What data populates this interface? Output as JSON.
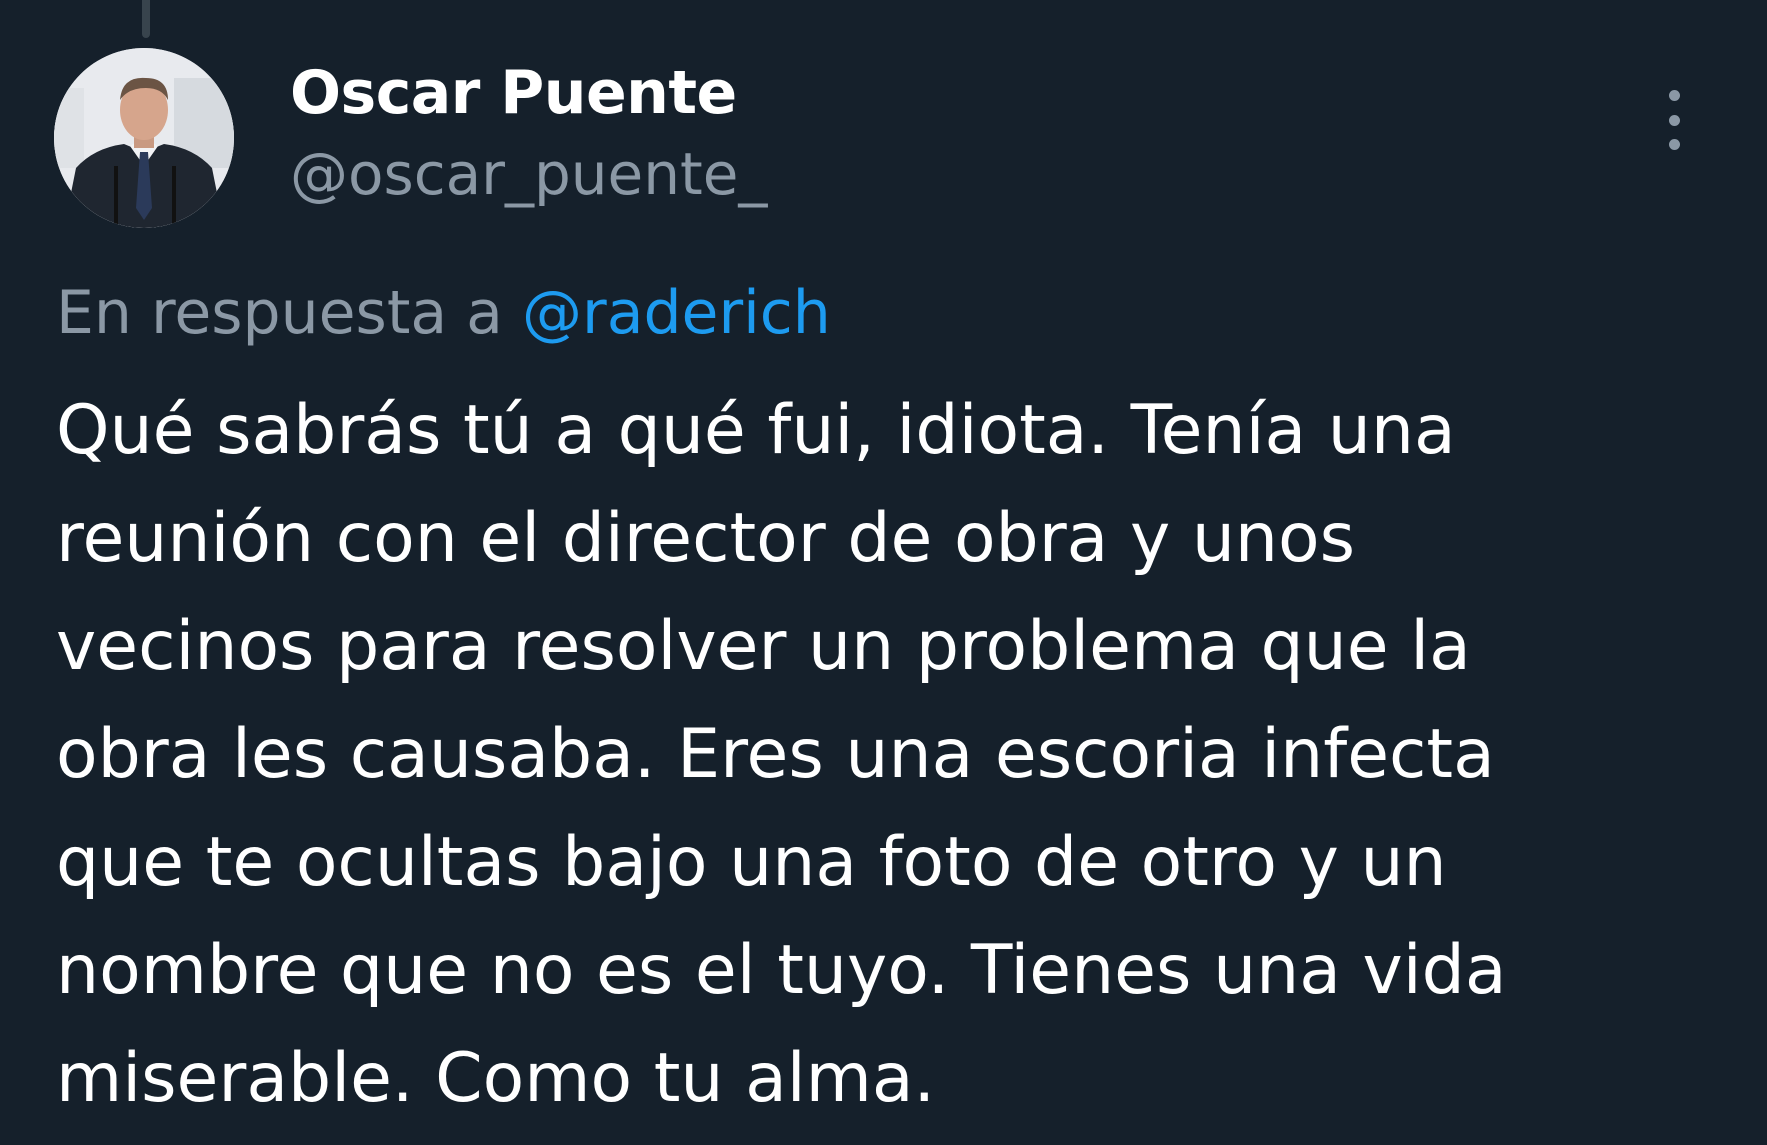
{
  "author": {
    "display_name": "Oscar Puente",
    "handle": "@oscar_puente_",
    "avatar_icon": "profile-photo"
  },
  "reply_to": {
    "prefix": "En respuesta a",
    "mention": "@raderich"
  },
  "tweet": {
    "lines": [
      "Qué sabrás tú a qué fui, idiota. Tenía una",
      "reunión con el director de obra y unos",
      "vecinos para resolver un problema que la",
      "obra les causaba. Eres una escoria infecta",
      "que te ocultas bajo una foto de otro y un",
      "nombre que no es el tuyo. Tienes una vida",
      "miserable. Como tu alma."
    ]
  },
  "icons": {
    "more": "more-vertical-icon"
  },
  "colors": {
    "background": "#15202b",
    "text_primary": "#ffffff",
    "text_secondary": "#8b98a5",
    "accent": "#1d9bf0"
  }
}
